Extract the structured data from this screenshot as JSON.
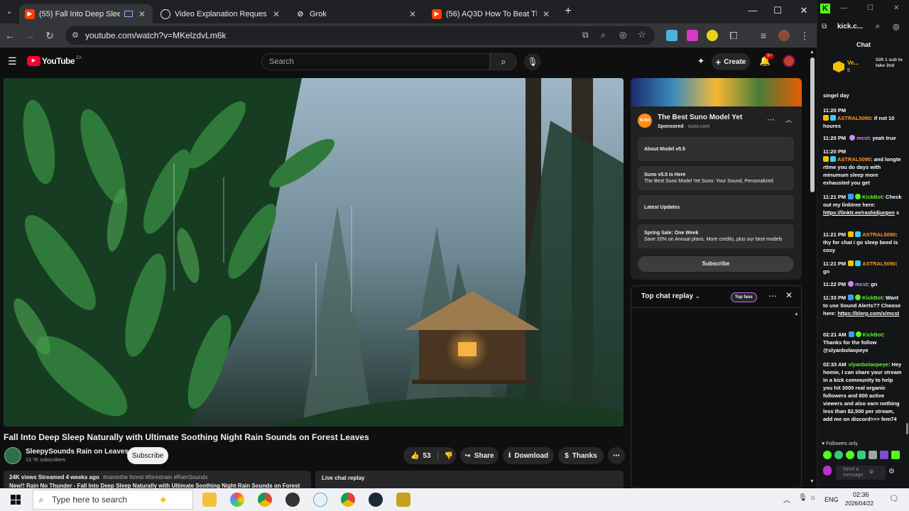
{
  "browser": {
    "tabs": [
      {
        "label": "(55) Fall Into Deep Sleep N",
        "active": true,
        "favicon_color": "#ff3d00"
      },
      {
        "label": "Video Explanation Request",
        "active": false,
        "favicon_color": "#e8eaed"
      },
      {
        "label": "Grok",
        "active": false,
        "favicon_color": "#e8eaed"
      },
      {
        "label": "(56) AQ3D How To Beat The Dj",
        "active": false,
        "favicon_color": "#ff3d00"
      }
    ],
    "new_tab_symbol": "+",
    "url": "youtube.com/watch?v=MKelzdvLm6k"
  },
  "youtube": {
    "logo_text": "YouTube",
    "region_code": "ZA",
    "search_placeholder": "Search",
    "create_label": "Create",
    "notification_count": "9+",
    "video": {
      "title": "Fall Into Deep Sleep Naturally with Ultimate Soothing Night Rain Sounds on Forest Leaves",
      "channel": "SleepySounds Rain on Leaves",
      "subscribers": "13.7K subscribers",
      "subscribe_label": "Subscribe",
      "likes": "53",
      "share_label": "Share",
      "download_label": "Download",
      "thanks_label": "Thanks",
      "views_line": "24K views  Streamed 4 weeks ago",
      "hashtags": "#raininthe forest #forestrain #RainSounds",
      "desc_preview": "New!! Rain No Thunder - Fall Into Deep Sleep Naturally with Ultimate Soothing Night Rain Sounds on Forest"
    },
    "ad": {
      "title": "The Best Suno Model Yet",
      "sponsored": "Sponsored",
      "domain": "suno.com",
      "brand": "SUNO",
      "links": [
        {
          "title": "About Model v5.5",
          "sub": ""
        },
        {
          "title": "Suno v5.5 Is Here",
          "sub": "The Best Suno Model Yet Suno: Your Sound, Personalized"
        },
        {
          "title": "Latest Updates",
          "sub": ""
        },
        {
          "title": "Spring Sale: One Week",
          "sub": "Save 20% on Annual plans. More credits, plus our best models"
        }
      ],
      "subscribe_label": "Subscribe"
    },
    "chat_replay": {
      "title": "Top chat replay",
      "badge": "Top fans",
      "live_chat_label": "Live chat replay"
    }
  },
  "kick": {
    "url": "kick.c...",
    "chat_title": "Chat",
    "top_user": {
      "name": "Ve...",
      "count": "5"
    },
    "gift_text": "Gift 1 sub to take 2nd",
    "first_line": "singel day",
    "messages": [
      {
        "time": "11:20 PM",
        "user": "ASTRAL5090",
        "color": "orange",
        "text": "if not 10 houres"
      },
      {
        "time": "11:20 PM",
        "user": "mcst",
        "color": "purple",
        "text": "yeah true"
      },
      {
        "time": "11:20 PM",
        "user": "ASTRAL5090",
        "color": "orange",
        "text": "and longte rtime you do days with minumum sleep more exhausted you get"
      },
      {
        "time": "11:21 PM",
        "user": "KickBot",
        "color": "green",
        "text": "Check out my linktree here:",
        "link": "https://linktr.ee/rashidjurgen",
        "link_tail": "s"
      },
      {
        "time": "11:21 PM",
        "user": "ASTRAL5090",
        "color": "orange",
        "text": "thy for chat i go sleep beed is cosy"
      },
      {
        "time": "11:21 PM",
        "user": "ASTRAL5090",
        "color": "orange",
        "text": "gn"
      },
      {
        "time": "11:22 PM",
        "user": "mcst",
        "color": "purple",
        "text": "gn"
      },
      {
        "time": "11:33 PM",
        "user": "KickBot",
        "color": "green",
        "text": "Want to use Sound Alerts?? Choose here:",
        "link": "https://blerp.com/x/mcst",
        "link_tail": ""
      },
      {
        "time": "02:21 AM",
        "user": "KickBot",
        "color": "green",
        "text": "Thanks for the follow @slyanbolaopeye",
        "link": "",
        "link_tail": ""
      },
      {
        "time": "02:33 AM",
        "user": "slyanbolaopeye",
        "color": "green",
        "text": "Hey homie, I can share your stream in a kick community to help you hit 3000 real organic followers and 800 active viewers and also earn nothing less than $2,500 per stream, add me on discord>>> fem74"
      }
    ],
    "followers_only": "Followers only",
    "send_placeholder": "Send a message"
  },
  "taskbar": {
    "search_placeholder": "Type here to search",
    "lang": "ENG",
    "time": "02:36",
    "date": "2026/04/22"
  }
}
